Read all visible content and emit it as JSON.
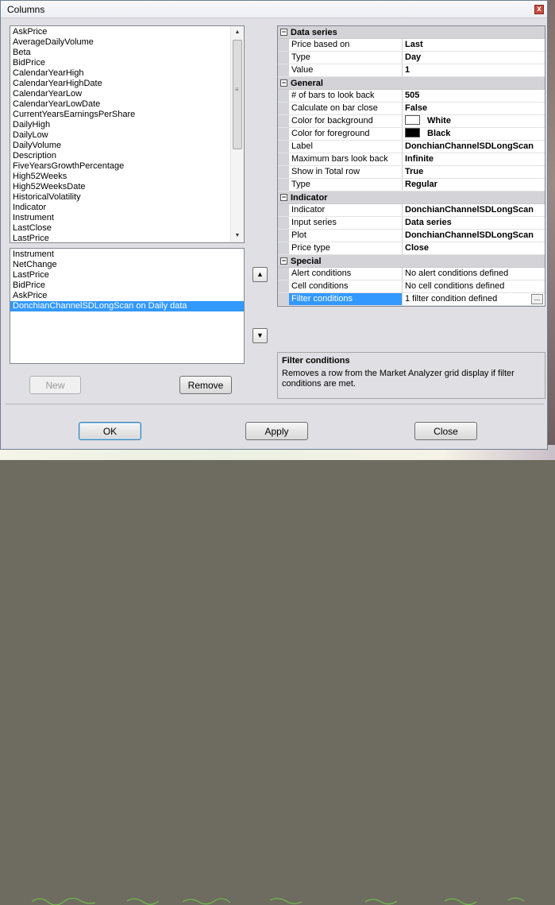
{
  "window": {
    "title": "Columns",
    "close_glyph": "x"
  },
  "available_columns": [
    "AskPrice",
    "AverageDailyVolume",
    "Beta",
    "BidPrice",
    "CalendarYearHigh",
    "CalendarYearHighDate",
    "CalendarYearLow",
    "CalendarYearLowDate",
    "CurrentYearsEarningsPerShare",
    "DailyHigh",
    "DailyLow",
    "DailyVolume",
    "Description",
    "FiveYearsGrowthPercentage",
    "High52Weeks",
    "High52WeeksDate",
    "HistoricalVolatility",
    "Indicator",
    "Instrument",
    "LastClose",
    "LastPrice"
  ],
  "selected_columns": [
    {
      "label": "Instrument",
      "selected": false
    },
    {
      "label": "NetChange",
      "selected": false
    },
    {
      "label": "LastPrice",
      "selected": false
    },
    {
      "label": "BidPrice",
      "selected": false
    },
    {
      "label": "AskPrice",
      "selected": false
    },
    {
      "label": "DonchianChannelSDLongScan on Daily data",
      "selected": true
    }
  ],
  "buttons": {
    "new": "New",
    "remove": "Remove",
    "ok": "OK",
    "apply": "Apply",
    "close": "Close",
    "move_up_glyph": "▲",
    "move_down_glyph": "▼",
    "ellipsis": "..."
  },
  "properties": {
    "data_series": {
      "header": "Data series",
      "rows": [
        {
          "name": "Price based on",
          "value": "Last"
        },
        {
          "name": "Type",
          "value": "Day"
        },
        {
          "name": "Value",
          "value": "1"
        }
      ]
    },
    "general": {
      "header": "General",
      "bars_lookback": {
        "name": "# of bars to look back",
        "value": "505"
      },
      "calc_on_close": {
        "name": "Calculate on bar close",
        "value": "False"
      },
      "color_bg": {
        "name": "Color for background",
        "value": "White",
        "swatch": "#ffffff"
      },
      "color_fg": {
        "name": "Color for foreground",
        "value": "Black",
        "swatch": "#000000"
      },
      "label": {
        "name": "Label",
        "value": "DonchianChannelSDLongScan"
      },
      "max_bars": {
        "name": "Maximum bars look back",
        "value": "Infinite"
      },
      "show_total": {
        "name": "Show in Total row",
        "value": "True"
      },
      "type": {
        "name": "Type",
        "value": "Regular"
      }
    },
    "indicator": {
      "header": "Indicator",
      "rows": [
        {
          "name": "Indicator",
          "value": "DonchianChannelSDLongScan"
        },
        {
          "name": "Input series",
          "value": "Data series"
        },
        {
          "name": "Plot",
          "value": "DonchianChannelSDLongScan"
        },
        {
          "name": "Price type",
          "value": "Close"
        }
      ]
    },
    "special": {
      "header": "Special",
      "alert": {
        "name": "Alert conditions",
        "value": "No alert conditions defined"
      },
      "cell": {
        "name": "Cell conditions",
        "value": "No cell conditions defined"
      },
      "filter": {
        "name": "Filter conditions",
        "value": "1 filter condition defined"
      }
    },
    "collapse_glyph": "−"
  },
  "description": {
    "title": "Filter conditions",
    "text": "Removes a row from the Market Analyzer grid display if filter conditions are met."
  },
  "colors": {
    "selection": "#3399ff",
    "dialog_bg": "#e0dfe3",
    "category_bg": "#d4d3d8"
  }
}
